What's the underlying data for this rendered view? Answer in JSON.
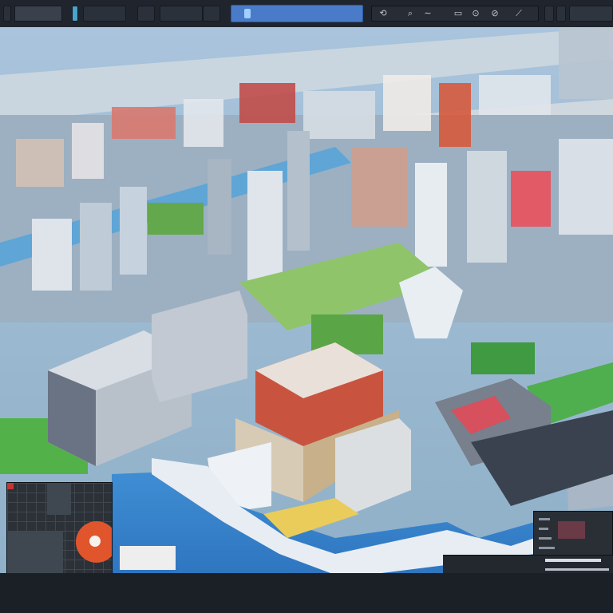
{
  "app": {
    "title_text": "",
    "search_label": "",
    "status_text": ""
  },
  "toolbar": {
    "icons": [
      "file-icon",
      "save-icon",
      "undo-icon",
      "zoom-icon",
      "pan-icon",
      "edit-icon",
      "rotate-icon",
      "layers-icon",
      "settings-icon"
    ]
  },
  "colors": {
    "toolbar_bg": "#20252d",
    "accent": "#4a7bc8",
    "minimap_marker": "#e0552c"
  }
}
